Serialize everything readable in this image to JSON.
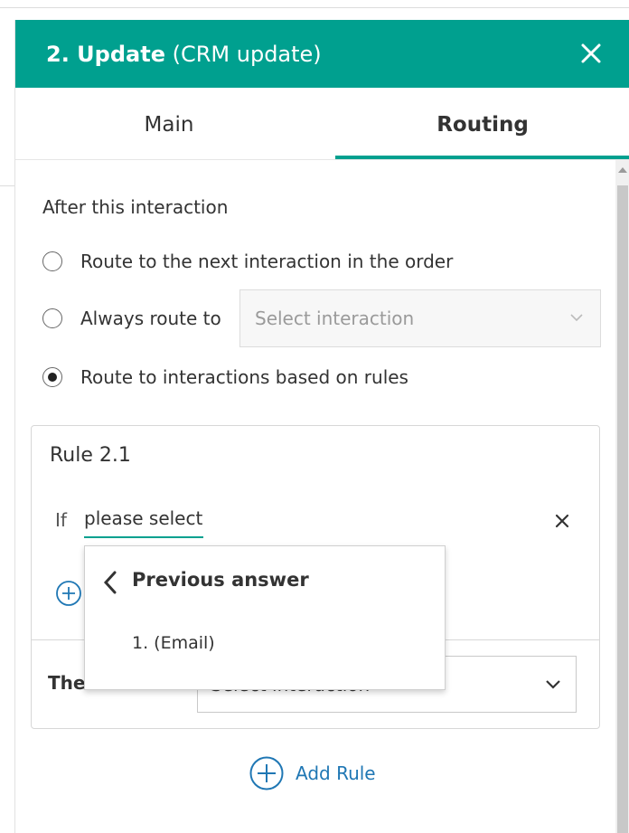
{
  "header": {
    "title_strong": "2. Update",
    "title_suffix": "(CRM update)"
  },
  "tabs": [
    {
      "label": "Main",
      "active": false
    },
    {
      "label": "Routing",
      "active": true
    }
  ],
  "routing": {
    "section_label": "After this interaction",
    "options": [
      {
        "label": "Route to the next interaction in the order",
        "checked": false
      },
      {
        "label": "Always route to",
        "checked": false
      },
      {
        "label": "Route to interactions based on rules",
        "checked": true
      }
    ],
    "always_route_placeholder": "Select interaction"
  },
  "rule": {
    "title": "Rule 2.1",
    "if_label": "If",
    "if_value": "please select",
    "then_label": "Then route to",
    "then_placeholder": "Select interaction"
  },
  "dropdown": {
    "header": "Previous answer",
    "items": [
      "1. (Email)"
    ]
  },
  "add_rule_label": "Add Rule",
  "colors": {
    "accent": "#00a08f",
    "link": "#1f77b4"
  }
}
